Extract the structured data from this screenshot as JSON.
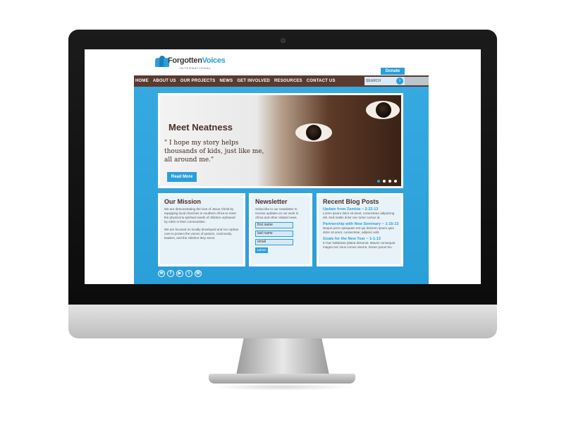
{
  "site": {
    "logo": {
      "word1": "Forgotten",
      "word2": "Voices",
      "subtitle": "INTERNATIONAL"
    },
    "donate_label": "Donate",
    "nav": [
      "HOME",
      "ABOUT US",
      "OUR PROJECTS",
      "NEWS",
      "GET INVOLVED",
      "RESOURCES",
      "CONTACT US"
    ],
    "search": {
      "placeholder": "SEARCH",
      "button_icon": "search-icon"
    },
    "hero": {
      "title": "Meet Neatness",
      "quote": "\" I hope my story helps thousands of kids, just like me, all around me.\"",
      "button_label": "Read More",
      "slide_count": 4,
      "active_slide": 1
    },
    "mission": {
      "title": "Our Mission",
      "paragraph1": "We are demonstrating the love of Jesus Christ by equipping local churches in southern Africa to meet the physical & spiritual needs of children orphaned by AIDS in their communities.",
      "paragraph2": "We are focused on locally developed and run orphan care to protect the voices of pastors, community leaders, and the children they serve."
    },
    "newsletter": {
      "title": "Newsletter",
      "description": "Subscribe to our newsletter to receive updates on our work in Africa and other related news.",
      "fields": [
        "first name",
        "last name",
        "email"
      ],
      "submit_label": "submit"
    },
    "blog": {
      "title": "Recent Blog Posts",
      "posts": [
        {
          "title": "Update from Zambia ~ 2-22-13",
          "excerpt": "Lorem ipsum dolor sit amet, consectetur adipiscing elit. Sed mattis dolor nec tortor cursus id."
        },
        {
          "title": "Partnership with New Seminary ~ 1-15-13",
          "excerpt": "Neque porro quisquam est qui dolorem ipsum quia dolor sit amet, consectetur, adipisci velit."
        },
        {
          "title": "Goals for the New Year ~ 1-1-13",
          "excerpt": "In hac habitasse platea dictumst. Mauris consequat magna nec risus cursus viverra. Donec purus leo."
        }
      ]
    },
    "social": [
      {
        "icon": "email-icon",
        "glyph": "✉"
      },
      {
        "icon": "facebook-icon",
        "glyph": "f"
      },
      {
        "icon": "youtube-icon",
        "glyph": "▶"
      },
      {
        "icon": "twitter-icon",
        "glyph": "t"
      },
      {
        "icon": "phone-icon",
        "glyph": "☏"
      }
    ]
  },
  "colors": {
    "brand_blue": "#2b9fdb",
    "nav_brown": "#5b3a30",
    "heading_brown": "#4a2f25"
  }
}
